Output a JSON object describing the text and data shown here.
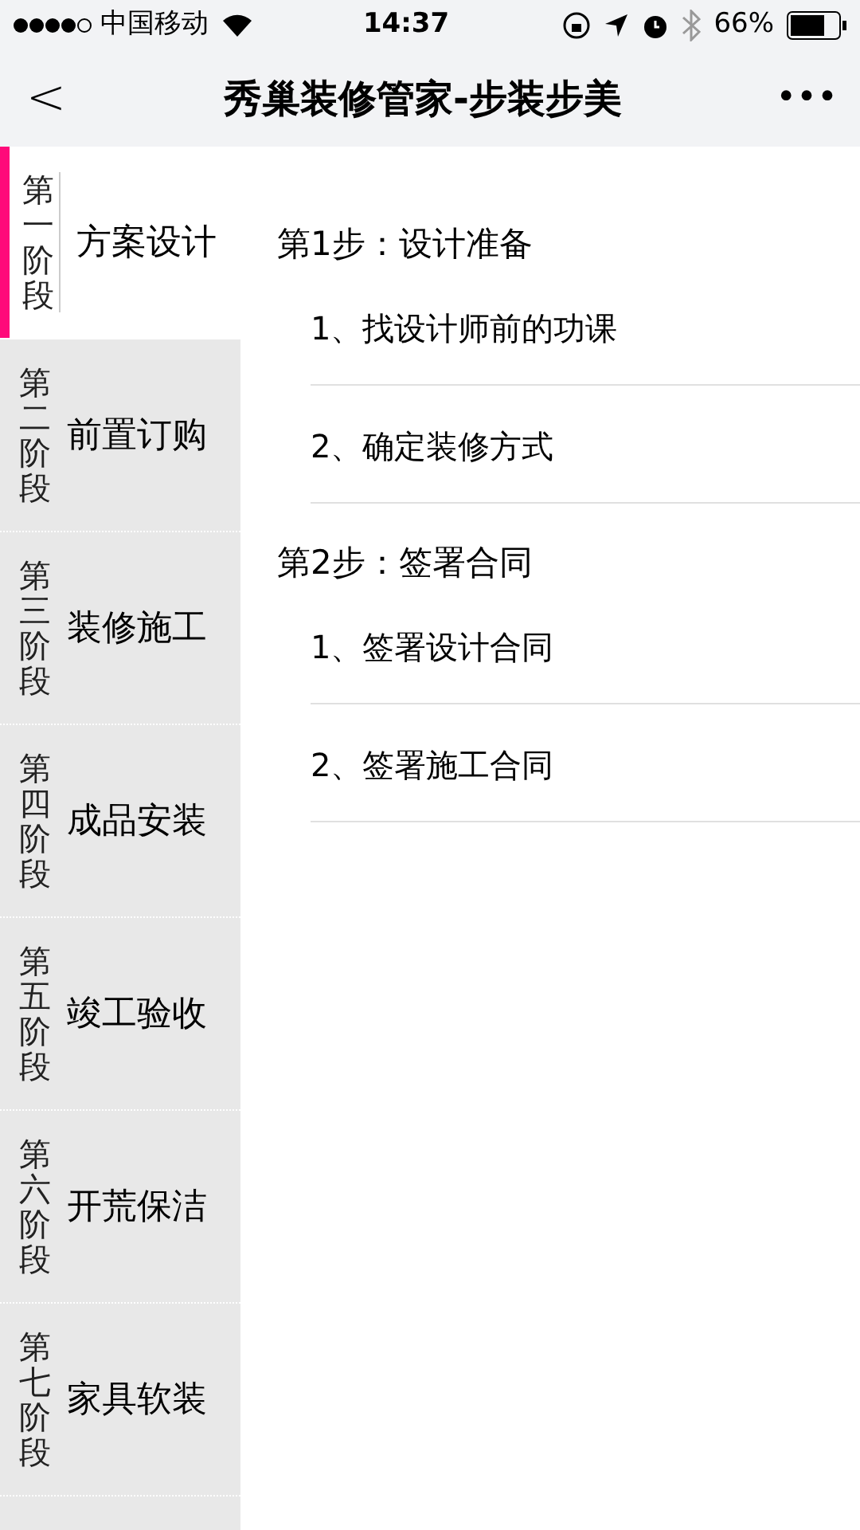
{
  "status_bar": {
    "signal_carrier": "中国移动",
    "time": "14:37",
    "battery": "66%"
  },
  "nav": {
    "back": "<",
    "title": "秀巢装修管家-步装步美",
    "more": "•••"
  },
  "sidebar": {
    "items": [
      {
        "stage": "第一阶段",
        "name": "方案设计",
        "selected": true
      },
      {
        "stage": "第二阶段",
        "name": "前置订购",
        "selected": false
      },
      {
        "stage": "第三阶段",
        "name": "装修施工",
        "selected": false
      },
      {
        "stage": "第四阶段",
        "name": "成品安装",
        "selected": false
      },
      {
        "stage": "第五阶段",
        "name": "竣工验收",
        "selected": false
      },
      {
        "stage": "第六阶段",
        "name": "开荒保洁",
        "selected": false
      },
      {
        "stage": "第七阶段",
        "name": "家具软装",
        "selected": false
      }
    ]
  },
  "steps": [
    {
      "title": "第1步：设计准备",
      "items": [
        "1、找设计师前的功课",
        "2、确定装修方式"
      ]
    },
    {
      "title": "第2步：签署合同",
      "items": [
        "1、签署设计合同",
        "2、签署施工合同"
      ]
    }
  ]
}
